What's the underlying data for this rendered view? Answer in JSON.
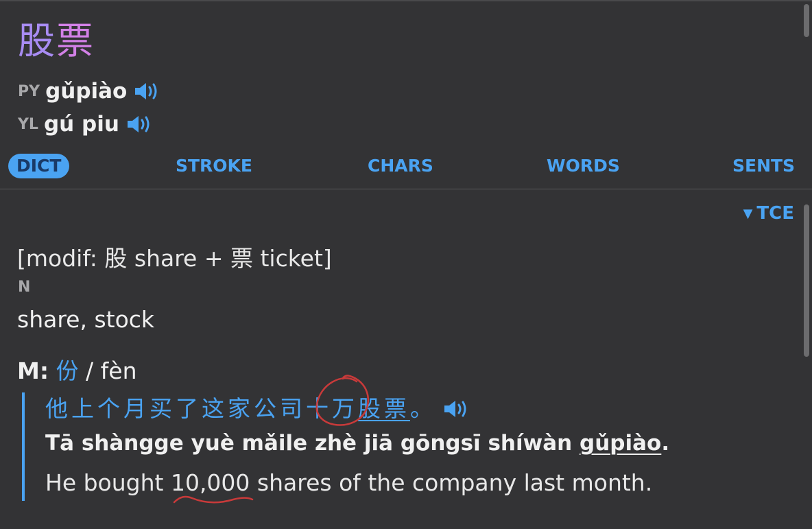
{
  "entry": {
    "headword_char1": "股",
    "headword_char2": "票",
    "pinyin_label": "PY",
    "pinyin": "gǔpiào",
    "jyutping_label": "YL",
    "jyutping": "gú piu"
  },
  "tabs": [
    "DICT",
    "STROKE",
    "CHARS",
    "WORDS",
    "SENTS"
  ],
  "source_toggle": {
    "arrow": "▼",
    "label": "TCE"
  },
  "definition": {
    "etymology_prefix": "[modif: ",
    "char1": "股",
    "part1": " share + ",
    "char2": "票",
    "part2": " ticket]",
    "part_of_speech": "N",
    "gloss": "share, stock"
  },
  "measure": {
    "label": "M:",
    "char": "份",
    "separator": " / ",
    "pinyin": "fèn"
  },
  "example": {
    "chinese_prefix": "他上个月买了这家公司十万",
    "chinese_word": "股票",
    "chinese_suffix": "。",
    "pinyin_prefix": "Tā shàngge yuè mǎile zhè jiā gōngsī shíwàn ",
    "pinyin_word": "gǔpiào",
    "pinyin_suffix": ".",
    "english": "He bought 10,000 shares of the company last month."
  },
  "colors": {
    "background": "#333335",
    "accent": "#4aa3f2",
    "headword_gradient_start": "#a88cf3",
    "headword_gradient_end": "#d280e6",
    "annotation": "#c93a3a"
  },
  "icons": [
    "speaker-icon",
    "triangle-down-icon"
  ]
}
